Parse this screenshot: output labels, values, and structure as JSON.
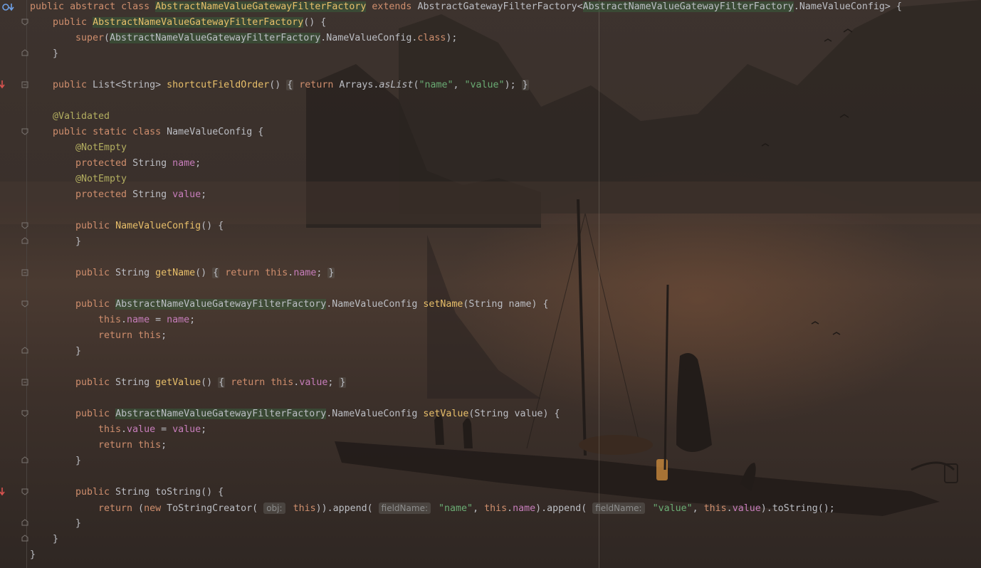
{
  "editor": {
    "language": "Java",
    "class_name": "AbstractNameValueGatewayFilterFactory",
    "lines": [
      "public abstract class AbstractNameValueGatewayFilterFactory extends AbstractGatewayFilterFactory<AbstractNameValueGatewayFilterFactory.NameValueConfig> {",
      "public AbstractNameValueGatewayFilterFactory() {",
      "super(AbstractNameValueGatewayFilterFactory.NameValueConfig.class);",
      "}",
      "public List<String> shortcutFieldOrder() { return Arrays.asList(\"name\", \"value\"); }",
      "@Validated",
      "public static class NameValueConfig {",
      "@NotEmpty",
      "protected String name;",
      "@NotEmpty",
      "protected String value;",
      "public NameValueConfig() {",
      "}",
      "public String getName() { return this.name; }",
      "public AbstractNameValueGatewayFilterFactory.NameValueConfig setName(String name) {",
      "this.name = name;",
      "return this;",
      "}",
      "public String getValue() { return this.value; }",
      "public AbstractNameValueGatewayFilterFactory.NameValueConfig setValue(String value) {",
      "this.value = value;",
      "return this;",
      "}",
      "public String toString() {",
      "return (new ToStringCreator( obj: this)).append( fieldName: \"name\", this.name).append( fieldName: \"value\", this.value).toString();",
      "}",
      "}",
      "}"
    ],
    "inlay_hints": [
      "obj:",
      "fieldName:",
      "fieldName:"
    ]
  },
  "colors": {
    "keyword": "#cf8e6d",
    "method": "#e8bf6a",
    "annotation": "#b3ae60",
    "field": "#c77dbb",
    "string": "#6aab73",
    "text": "#bcbec4"
  },
  "gutter_icons": [
    "implementation-icon",
    "override-icon",
    "fold-icon"
  ]
}
